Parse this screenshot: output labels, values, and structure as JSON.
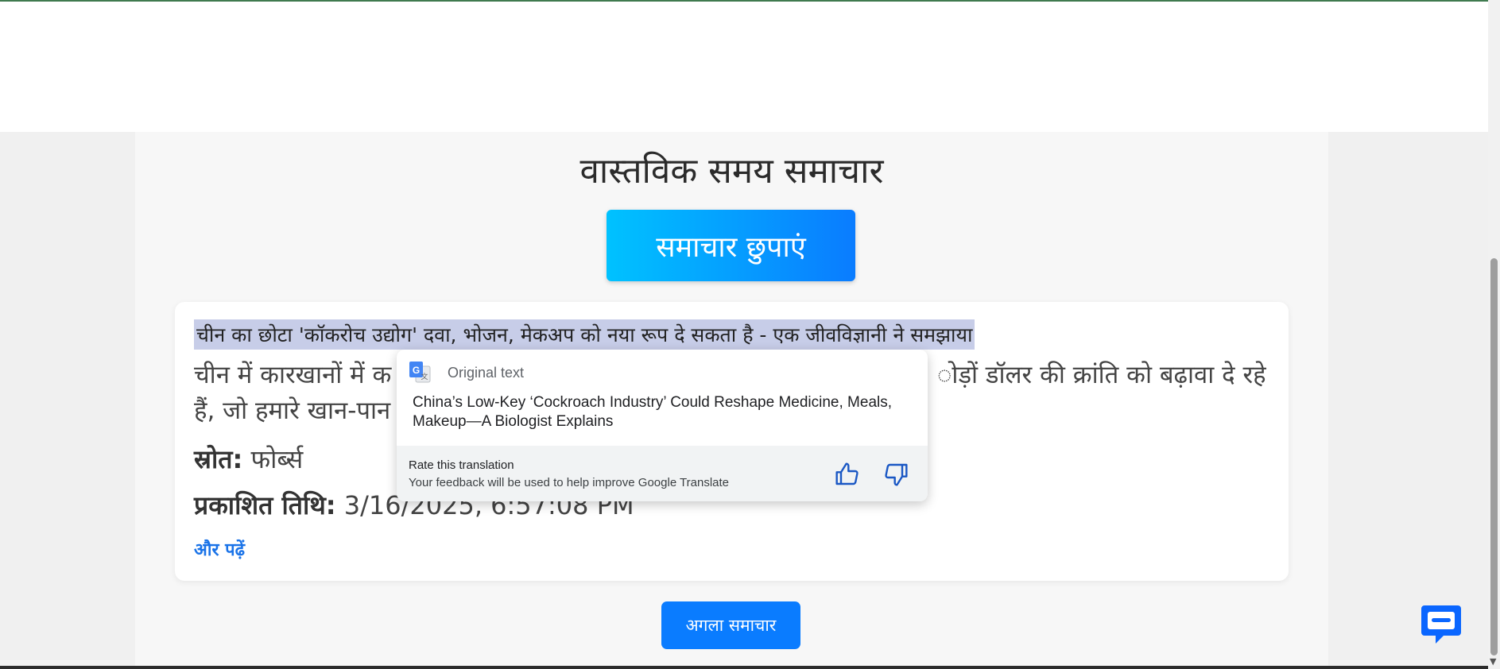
{
  "page": {
    "title": "वास्तविक समय समाचार",
    "hide_news_label": "समाचार छुपाएं",
    "next_news_label": "अगला समाचार"
  },
  "article": {
    "headline": "चीन का छोटा 'कॉकरोच उद्योग' दवा, भोजन, मेकअप को नया रूप दे सकता है - एक जीवविज्ञानी ने समझाया",
    "summary_line1_start": "चीन में कारखानों में क",
    "summary_line1_end": "ोड़ों डॉलर की क्रांति को बढ़ावा दे रहे",
    "summary_line2_start": "हैं, जो हमारे खान-पान",
    "source_label": "स्रोत:",
    "source_value": "फोर्ब्स",
    "date_label": "प्रकाशित तिथि:",
    "date_value": "3/16/2025, 6:57:08 PM",
    "read_more": "और पढ़ें"
  },
  "translate_popup": {
    "header": "Original text",
    "original_text": "China’s Low-Key ‘Cockroach Industry’ Could Reshape Medicine, Meals, Makeup—A Biologist Explains",
    "rate_title": "Rate this translation",
    "rate_subtitle": "Your feedback will be used to help improve Google Translate"
  },
  "colors": {
    "accent": "#0a7cff",
    "gradient_start": "#00c2ff",
    "link": "#1a73e8",
    "selection": "#c7cde8"
  },
  "icons": [
    "google-translate-icon",
    "thumbs-up-icon",
    "thumbs-down-icon",
    "chat-icon"
  ]
}
